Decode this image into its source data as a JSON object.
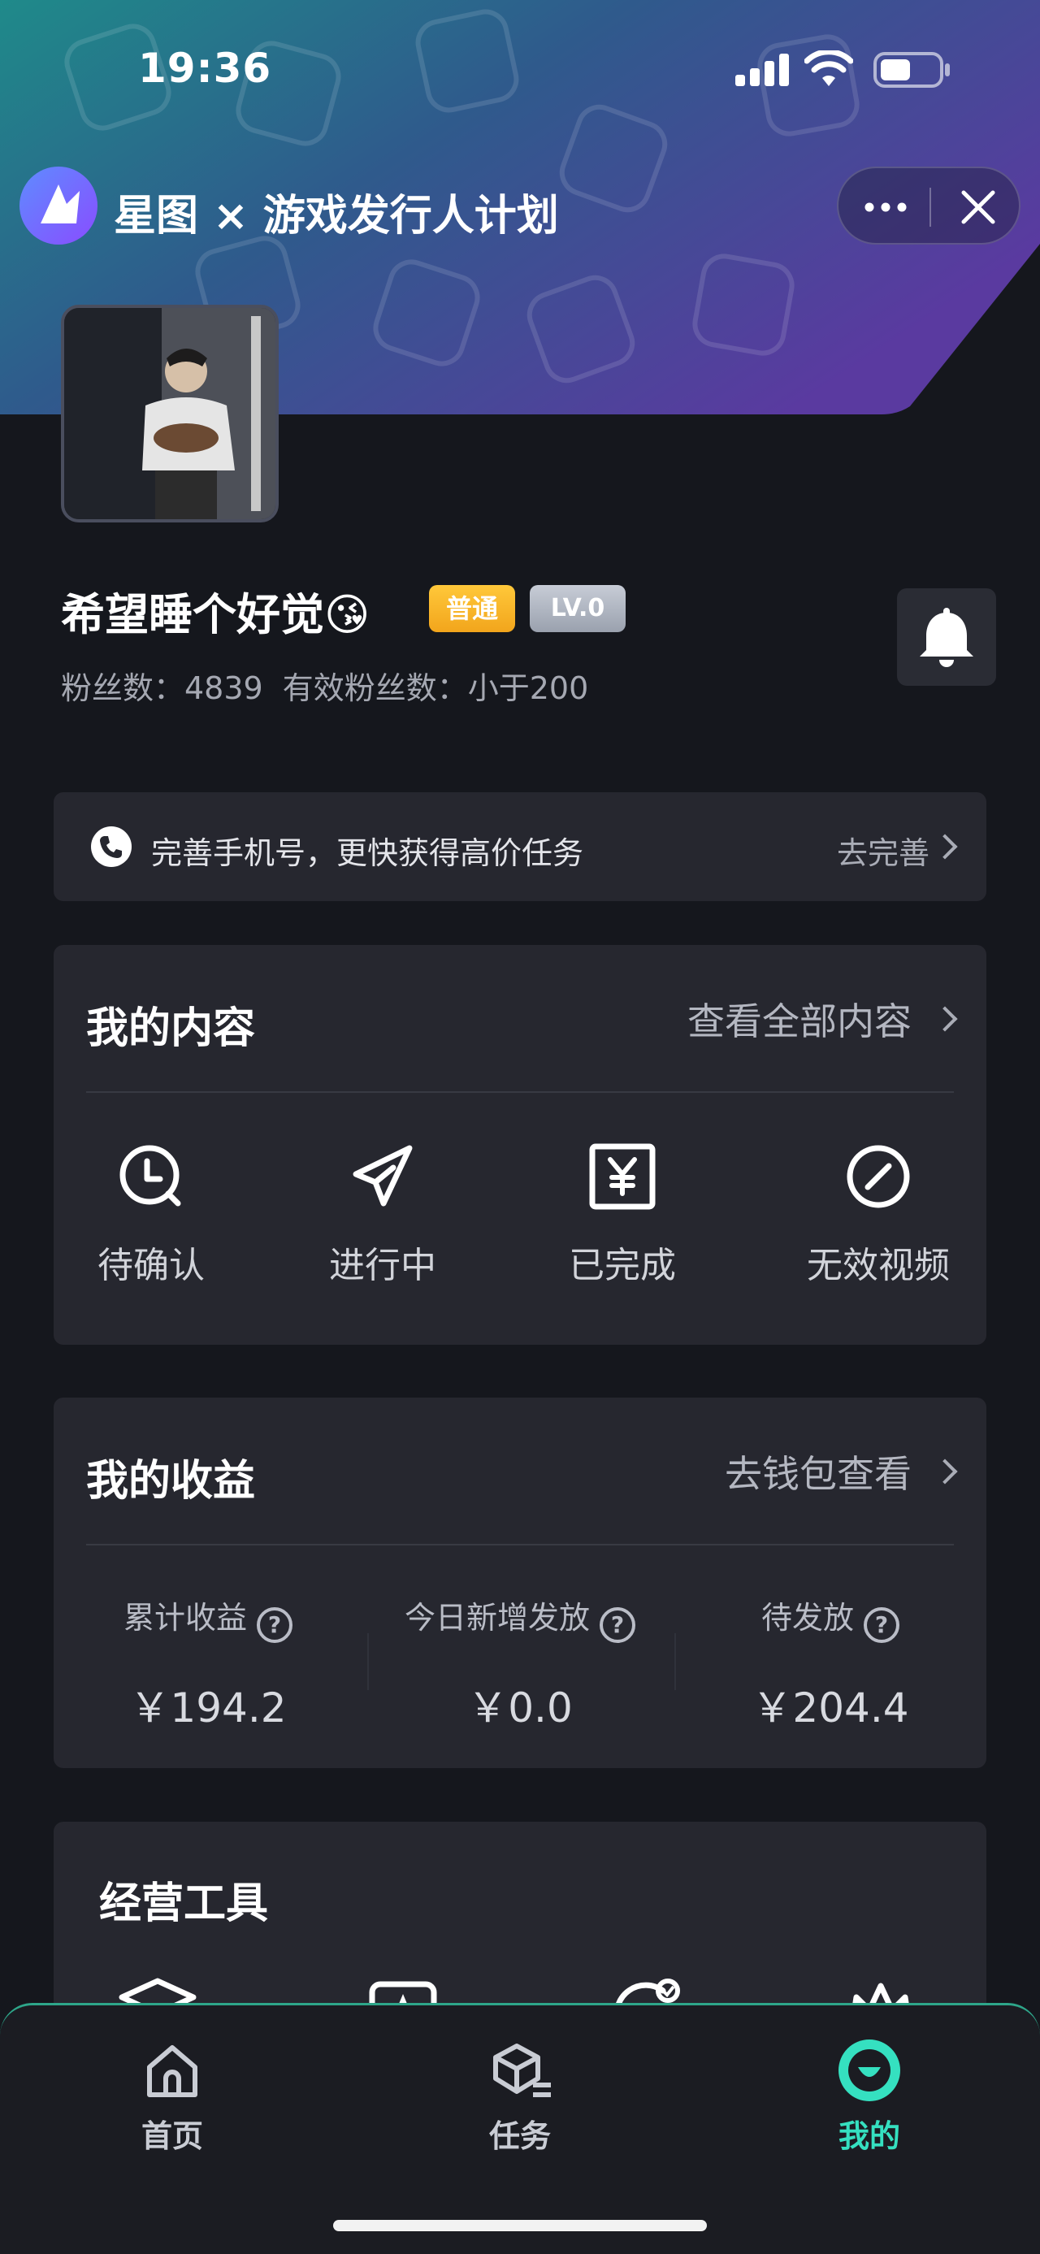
{
  "status_bar": {
    "time": "19:36"
  },
  "header": {
    "app_title": "星图 × 游戏发行人计划",
    "more_icon": "more-dots-icon",
    "close_icon": "close-icon"
  },
  "profile": {
    "username": "希望睡个好觉😘",
    "badge_level_type": "普通",
    "badge_level": "LV.0",
    "fans_label": "粉丝数：4839",
    "effective_fans_label": "有效粉丝数：小于200"
  },
  "phone_prompt": {
    "text": "完善手机号，更快获得高价任务",
    "action": "去完善"
  },
  "my_content": {
    "title": "我的内容",
    "link": "查看全部内容",
    "items": [
      {
        "label": "待确认",
        "icon": "clock-icon"
      },
      {
        "label": "进行中",
        "icon": "paper-plane-icon"
      },
      {
        "label": "已完成",
        "icon": "yen-receipt-icon"
      },
      {
        "label": "无效视频",
        "icon": "invalid-circle-icon"
      }
    ]
  },
  "my_earnings": {
    "title": "我的收益",
    "link": "去钱包查看",
    "columns": [
      {
        "label": "累计收益",
        "value": "￥194.2"
      },
      {
        "label": "今日新增发放",
        "value": "￥0.0"
      },
      {
        "label": "待发放",
        "value": "￥204.4"
      }
    ]
  },
  "tools": {
    "title": "经营工具"
  },
  "tabbar": {
    "tabs": [
      {
        "label": "首页",
        "icon": "home-icon"
      },
      {
        "label": "任务",
        "icon": "task-box-icon"
      },
      {
        "label": "我的",
        "icon": "profile-icon",
        "active": true
      }
    ]
  },
  "colors": {
    "accent": "#35e0c0",
    "badge_gold": "#f2a51c",
    "background": "#15171d",
    "card": "#26272f"
  }
}
